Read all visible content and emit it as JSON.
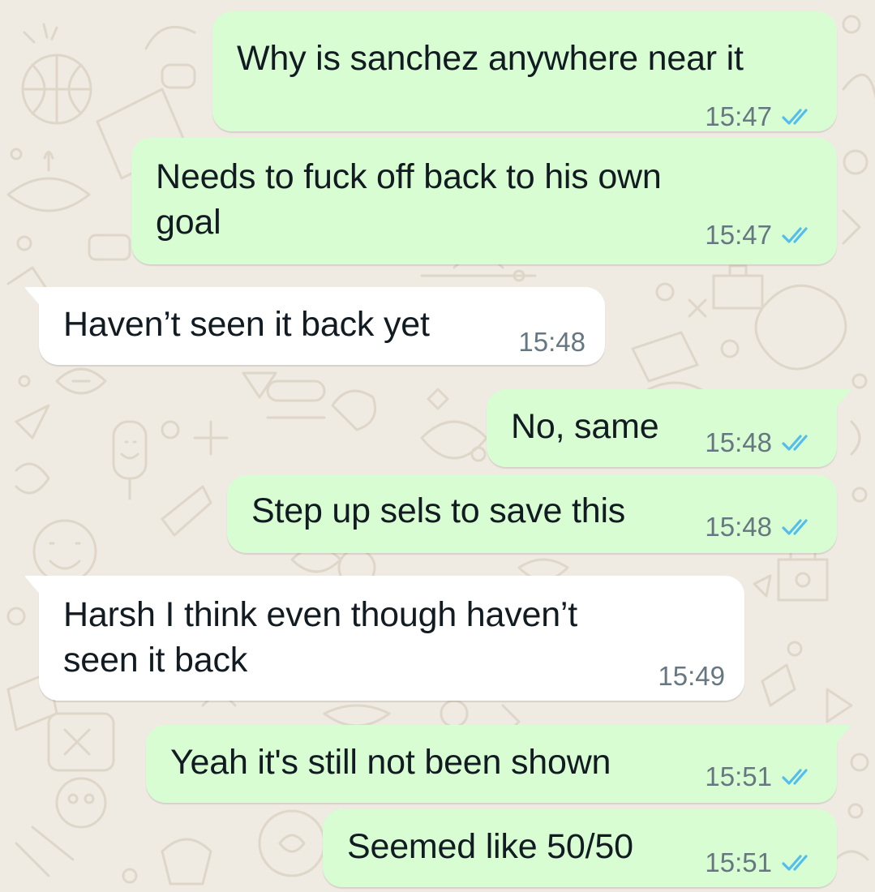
{
  "theme": {
    "background": "#efeae2",
    "outgoing_bubble": "#d9fdd3",
    "incoming_bubble": "#ffffff",
    "text": "#111b21",
    "timestamp": "#667781",
    "read_ticks": "#53bdeb"
  },
  "messages": [
    {
      "direction": "outgoing",
      "lines": [
        "Why is sanchez anywhere near it"
      ],
      "time": "15:47",
      "status": "read-double-tick-icon"
    },
    {
      "direction": "outgoing",
      "lines": [
        "Needs to fuck off back to his own",
        "goal"
      ],
      "time": "15:47",
      "status": "read-double-tick-icon"
    },
    {
      "direction": "incoming",
      "lines": [
        "Haven’t seen it back yet"
      ],
      "time": "15:48"
    },
    {
      "direction": "outgoing",
      "lines": [
        "No, same"
      ],
      "time": "15:48",
      "status": "read-double-tick-icon"
    },
    {
      "direction": "outgoing",
      "lines": [
        "Step up sels to save this"
      ],
      "time": "15:48",
      "status": "read-double-tick-icon"
    },
    {
      "direction": "incoming",
      "lines": [
        "Harsh I think even though haven’t",
        "seen it back"
      ],
      "time": "15:49"
    },
    {
      "direction": "outgoing",
      "lines": [
        "Yeah it's still not been shown"
      ],
      "time": "15:51",
      "status": "read-double-tick-icon"
    },
    {
      "direction": "outgoing",
      "lines": [
        "Seemed like 50/50"
      ],
      "time": "15:51",
      "status": "read-double-tick-icon"
    }
  ]
}
